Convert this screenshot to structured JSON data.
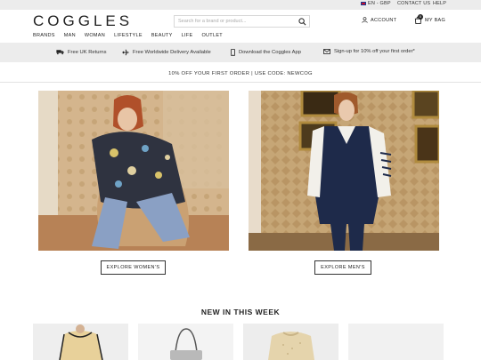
{
  "util_bar": {
    "locale": "EN - GBP",
    "contact": "CONTACT US",
    "help": "HELP"
  },
  "header": {
    "logo": "COGGLES",
    "search_placeholder": "Search for a brand or product...",
    "account": "ACCOUNT",
    "bag": "MY BAG",
    "bag_count": "0",
    "nav": [
      "BRANDS",
      "MAN",
      "WOMAN",
      "LIFESTYLE",
      "BEAUTY",
      "LIFE",
      "OUTLET"
    ]
  },
  "perks": [
    {
      "icon": "truck-icon",
      "label": "Free UK Returns"
    },
    {
      "icon": "plane-icon",
      "label": "Free Worldwide Delivery Available"
    },
    {
      "icon": "phone-icon",
      "label": "Download the Coggles App"
    },
    {
      "icon": "mail-icon",
      "label": "Sign-up for 10% off your first order*"
    }
  ],
  "promo": "10% OFF YOUR FIRST ORDER | USE CODE: NEWCOG",
  "hero": {
    "women_cta": "EXPLORE WOMEN'S",
    "men_cta": "EXPLORE MEN'S"
  },
  "new_in": {
    "title": "NEW IN THIS WEEK"
  },
  "colors": {
    "util_bg": "#ececec",
    "accent": "#222222"
  }
}
